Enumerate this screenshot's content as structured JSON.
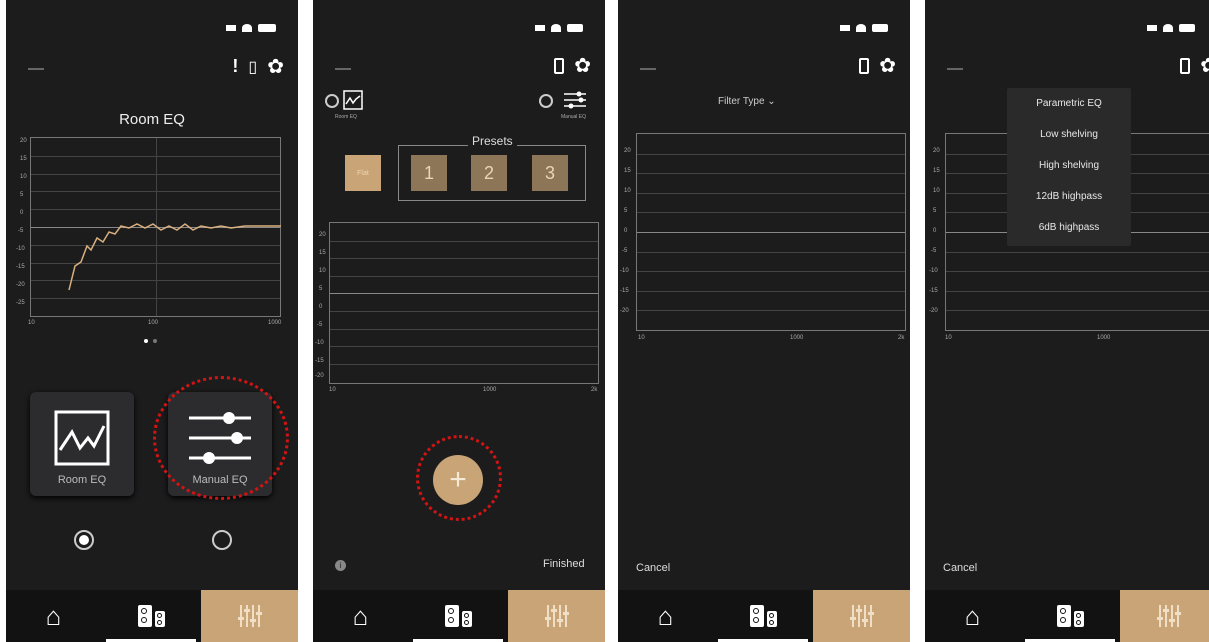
{
  "screen1": {
    "title": "Room EQ",
    "y_ticks": [
      "20",
      "15",
      "10",
      "5",
      "0",
      "-5",
      "-10",
      "-15",
      "-20",
      "-25"
    ],
    "x_ticks": [
      "10",
      "100",
      "1000"
    ],
    "room_eq_label": "Room EQ",
    "manual_eq_label": "Manual EQ",
    "curve_color": "#d9b07f"
  },
  "screen2": {
    "room_eq_label": "Room EQ",
    "manual_eq_label": "Manual EQ",
    "presets_label": "Presets",
    "flat_label": "Flat",
    "presets": [
      "1",
      "2",
      "3"
    ],
    "y_ticks": [
      "20",
      "15",
      "10",
      "5",
      "0",
      "-5",
      "-10",
      "-15",
      "-20"
    ],
    "x_ticks": [
      "10",
      "1000",
      "2k"
    ],
    "add_label": "+",
    "finished_label": "Finished"
  },
  "screen3": {
    "filter_type_label": "Filter Type",
    "y_ticks": [
      "20",
      "15",
      "10",
      "5",
      "0",
      "-5",
      "-10",
      "-15",
      "-20"
    ],
    "x_ticks": [
      "10",
      "1000",
      "2k"
    ],
    "cancel_label": "Cancel"
  },
  "screen4": {
    "y_ticks": [
      "20",
      "15",
      "10",
      "5",
      "0",
      "-5",
      "-10",
      "-15",
      "-20"
    ],
    "x_ticks": [
      "10",
      "1000"
    ],
    "filter_options": [
      "Parametric EQ",
      "Low shelving",
      "High shelving",
      "12dB highpass",
      "6dB highpass"
    ],
    "cancel_label": "Cancel"
  },
  "colors": {
    "accent": "#c8a477",
    "highlight": "#d21414",
    "background": "#1c1c1d"
  },
  "icons": [
    "home-icon",
    "speakers-icon",
    "equalizer-icon",
    "gear-icon",
    "phone-icon",
    "plus-icon",
    "info-icon"
  ]
}
